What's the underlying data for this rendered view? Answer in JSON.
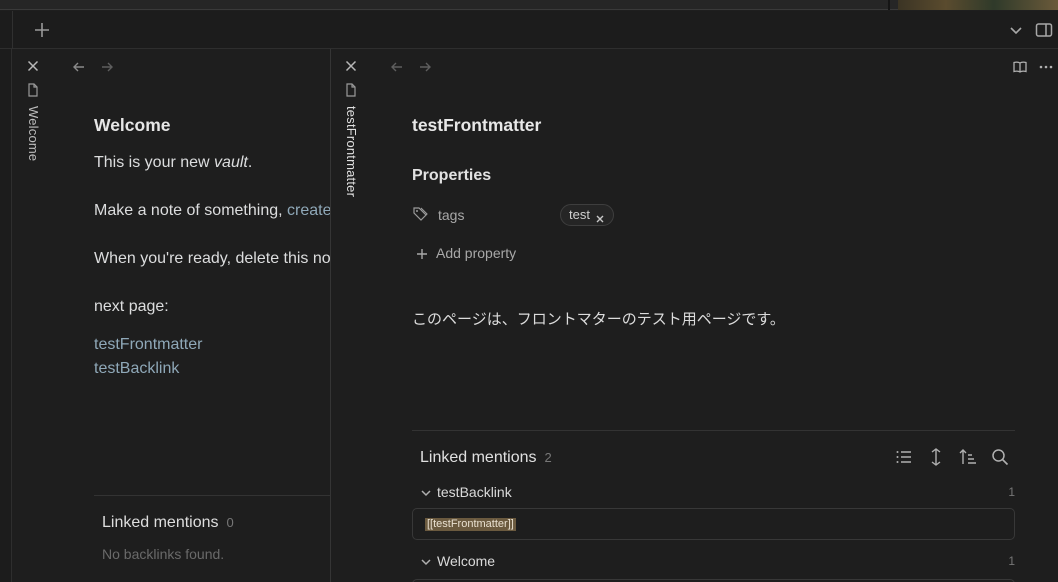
{
  "tabbar": {
    "new_tab_icon": "plus-icon",
    "tab_list_icon": "chevron-down-icon",
    "sidebar_icon": "sidebar-toggle-icon"
  },
  "pane_left": {
    "tab_title": "Welcome",
    "heading": "Welcome",
    "line1_prefix": "This is your new ",
    "line1_em": "vault",
    "line1_suffix": ".",
    "line2_prefix": "Make a note of something, ",
    "line2_link": "create",
    "line3": "When you're ready, delete this no",
    "line4": "next page:",
    "links": [
      "testFrontmatter",
      "testBacklink"
    ],
    "linked_mentions_title": "Linked mentions",
    "linked_mentions_count": "0",
    "no_backlinks": "No backlinks found."
  },
  "pane_right": {
    "tab_title": "testFrontmatter",
    "title": "testFrontmatter",
    "properties_heading": "Properties",
    "property_key": "tags",
    "tag_value": "test",
    "add_property": "Add property",
    "body_text": "このページは、フロントマターのテスト用ページです。",
    "linked_mentions_title": "Linked mentions",
    "linked_mentions_count": "2",
    "groups": [
      {
        "name": "testBacklink",
        "count": "1",
        "snippet": "[[testFrontmatter]]"
      },
      {
        "name": "Welcome",
        "count": "1"
      }
    ]
  }
}
